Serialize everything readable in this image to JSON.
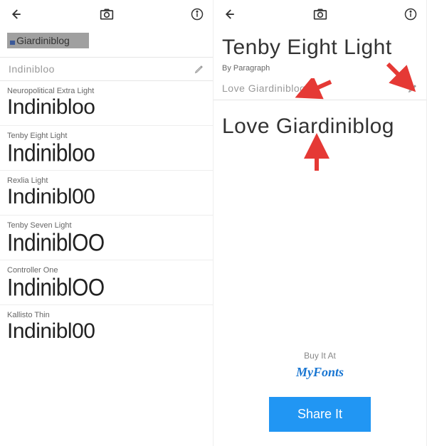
{
  "left": {
    "logo_text": "Giardiniblog",
    "input_value": "Indinibloo",
    "fonts": [
      {
        "name": "Neuropolitical Extra Light",
        "sample": "Indinibloo"
      },
      {
        "name": "Tenby Eight Light",
        "sample": "Indinibloo"
      },
      {
        "name": "Rexlia Light",
        "sample": "Indinibl00"
      },
      {
        "name": "Tenby Seven Light",
        "sample": "IndiniblOO"
      },
      {
        "name": "Controller One",
        "sample": "IndiniblOO"
      },
      {
        "name": "Kallisto Thin",
        "sample": "Indinibl00"
      }
    ]
  },
  "right": {
    "title": "Tenby Eight Light",
    "subtitle": "By Paragraph",
    "input_value": "Love Giardiniblog",
    "preview": "Love Giardiniblog",
    "buy_label": "Buy It At",
    "vendor": "MyFonts",
    "share_label": "Share It"
  }
}
